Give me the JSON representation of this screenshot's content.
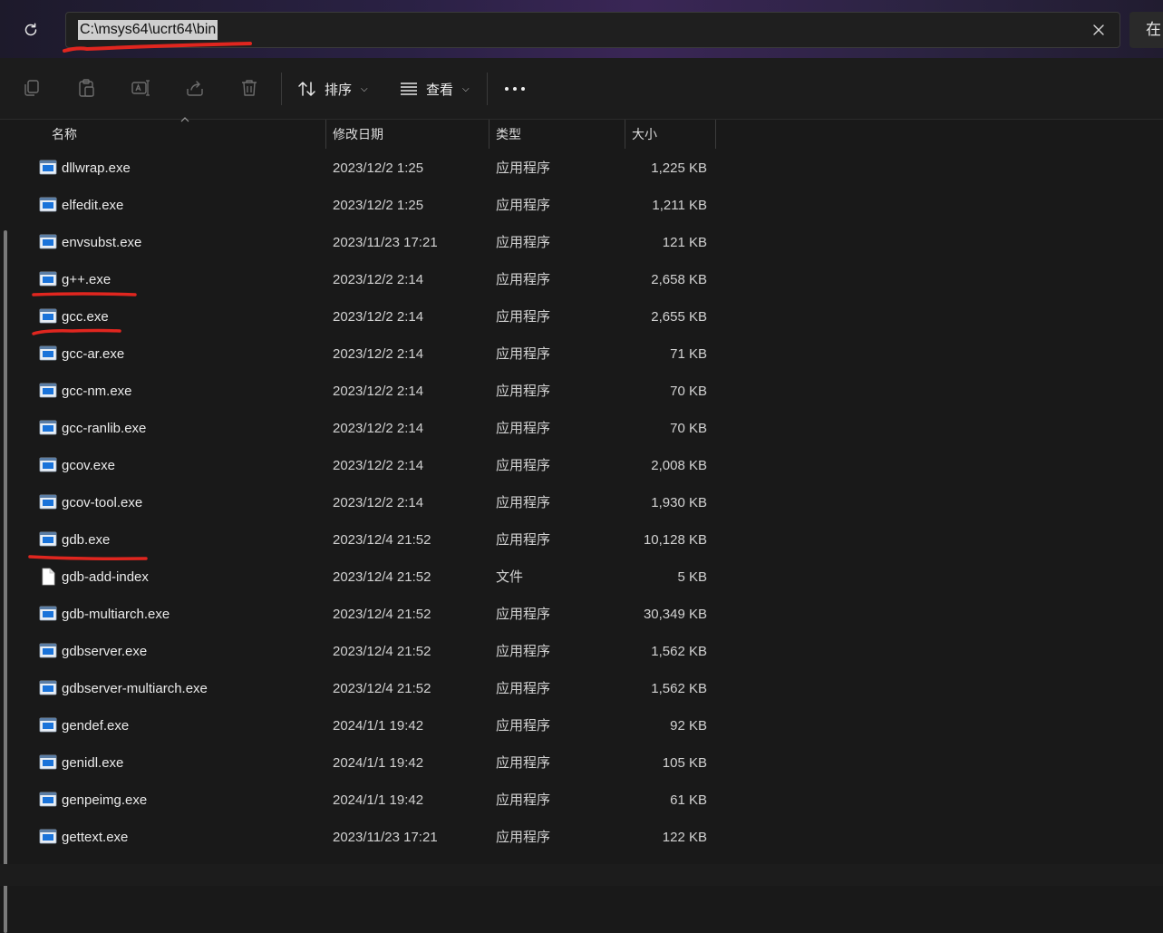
{
  "address": {
    "path": "C:\\msys64\\ucrt64\\bin",
    "right_button_label": "在"
  },
  "toolbar": {
    "sort_label": "排序",
    "view_label": "查看"
  },
  "columns": {
    "name": "名称",
    "modified": "修改日期",
    "type": "类型",
    "size": "大小"
  },
  "files": [
    {
      "name": "dllwrap.exe",
      "modified": "2023/12/2 1:25",
      "type": "应用程序",
      "size": "1,225 KB",
      "icon": "exe-icon"
    },
    {
      "name": "elfedit.exe",
      "modified": "2023/12/2 1:25",
      "type": "应用程序",
      "size": "1,211 KB",
      "icon": "exe-icon"
    },
    {
      "name": "envsubst.exe",
      "modified": "2023/11/23 17:21",
      "type": "应用程序",
      "size": "121 KB",
      "icon": "exe-icon"
    },
    {
      "name": "g++.exe",
      "modified": "2023/12/2 2:14",
      "type": "应用程序",
      "size": "2,658 KB",
      "icon": "exe-icon"
    },
    {
      "name": "gcc.exe",
      "modified": "2023/12/2 2:14",
      "type": "应用程序",
      "size": "2,655 KB",
      "icon": "exe-icon"
    },
    {
      "name": "gcc-ar.exe",
      "modified": "2023/12/2 2:14",
      "type": "应用程序",
      "size": "71 KB",
      "icon": "exe-icon"
    },
    {
      "name": "gcc-nm.exe",
      "modified": "2023/12/2 2:14",
      "type": "应用程序",
      "size": "70 KB",
      "icon": "exe-icon"
    },
    {
      "name": "gcc-ranlib.exe",
      "modified": "2023/12/2 2:14",
      "type": "应用程序",
      "size": "70 KB",
      "icon": "exe-icon"
    },
    {
      "name": "gcov.exe",
      "modified": "2023/12/2 2:14",
      "type": "应用程序",
      "size": "2,008 KB",
      "icon": "exe-icon"
    },
    {
      "name": "gcov-tool.exe",
      "modified": "2023/12/2 2:14",
      "type": "应用程序",
      "size": "1,930 KB",
      "icon": "exe-icon"
    },
    {
      "name": "gdb.exe",
      "modified": "2023/12/4 21:52",
      "type": "应用程序",
      "size": "10,128 KB",
      "icon": "exe-icon"
    },
    {
      "name": "gdb-add-index",
      "modified": "2023/12/4 21:52",
      "type": "文件",
      "size": "5 KB",
      "icon": "file-icon"
    },
    {
      "name": "gdb-multiarch.exe",
      "modified": "2023/12/4 21:52",
      "type": "应用程序",
      "size": "30,349 KB",
      "icon": "exe-icon"
    },
    {
      "name": "gdbserver.exe",
      "modified": "2023/12/4 21:52",
      "type": "应用程序",
      "size": "1,562 KB",
      "icon": "exe-icon"
    },
    {
      "name": "gdbserver-multiarch.exe",
      "modified": "2023/12/4 21:52",
      "type": "应用程序",
      "size": "1,562 KB",
      "icon": "exe-icon"
    },
    {
      "name": "gendef.exe",
      "modified": "2024/1/1 19:42",
      "type": "应用程序",
      "size": "92 KB",
      "icon": "exe-icon"
    },
    {
      "name": "genidl.exe",
      "modified": "2024/1/1 19:42",
      "type": "应用程序",
      "size": "105 KB",
      "icon": "exe-icon"
    },
    {
      "name": "genpeimg.exe",
      "modified": "2024/1/1 19:42",
      "type": "应用程序",
      "size": "61 KB",
      "icon": "exe-icon"
    },
    {
      "name": "gettext.exe",
      "modified": "2023/11/23 17:21",
      "type": "应用程序",
      "size": "122 KB",
      "icon": "exe-icon"
    }
  ],
  "annotation_color": "#e0261f"
}
